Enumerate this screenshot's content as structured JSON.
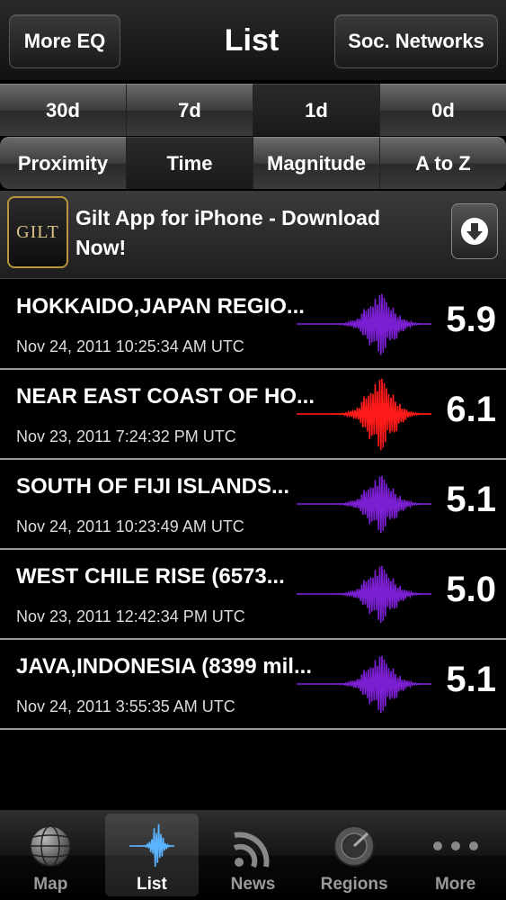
{
  "navbar": {
    "left_button": "More EQ",
    "title": "List",
    "right_button": "Soc. Networks"
  },
  "period_segments": [
    {
      "label": "30d",
      "selected": false
    },
    {
      "label": "7d",
      "selected": false
    },
    {
      "label": "1d",
      "selected": true
    },
    {
      "label": "0d",
      "selected": false
    }
  ],
  "sort_segments": [
    {
      "label": "Proximity",
      "selected": false
    },
    {
      "label": "Time",
      "selected": true
    },
    {
      "label": "Magnitude",
      "selected": false
    },
    {
      "label": "A to Z",
      "selected": false
    }
  ],
  "ad": {
    "logo_text": "GILT",
    "line1": "Gilt App for iPhone - Download",
    "line2": "Now!",
    "button_icon": "download-arrow-icon"
  },
  "earthquakes": [
    {
      "title": "HOKKAIDO,JAPAN REGIO...",
      "time": "Nov 24, 2011 10:25:34 AM UTC",
      "magnitude": "5.9",
      "color": "#7a1fd1"
    },
    {
      "title": "NEAR EAST COAST OF HO...",
      "time": "Nov 23, 2011 7:24:32 PM UTC",
      "magnitude": "6.1",
      "color": "#ff1a1a"
    },
    {
      "title": "SOUTH OF FIJI ISLANDS...",
      "time": "Nov 24, 2011 10:23:49 AM UTC",
      "magnitude": "5.1",
      "color": "#7a1fd1"
    },
    {
      "title": "WEST CHILE RISE (6573...",
      "time": "Nov 23, 2011 12:42:34 PM UTC",
      "magnitude": "5.0",
      "color": "#7a1fd1"
    },
    {
      "title": "JAVA,INDONESIA (8399 mil...",
      "time": "Nov 24, 2011 3:55:35 AM UTC",
      "magnitude": "5.1",
      "color": "#7a1fd1"
    }
  ],
  "tabs": [
    {
      "label": "Map",
      "icon": "globe-icon",
      "active": false
    },
    {
      "label": "List",
      "icon": "seismic-wave-icon",
      "active": true
    },
    {
      "label": "News",
      "icon": "rss-feed-icon",
      "active": false
    },
    {
      "label": "Regions",
      "icon": "radar-icon",
      "active": false
    },
    {
      "label": "More",
      "icon": "more-dots-icon",
      "active": false
    }
  ]
}
